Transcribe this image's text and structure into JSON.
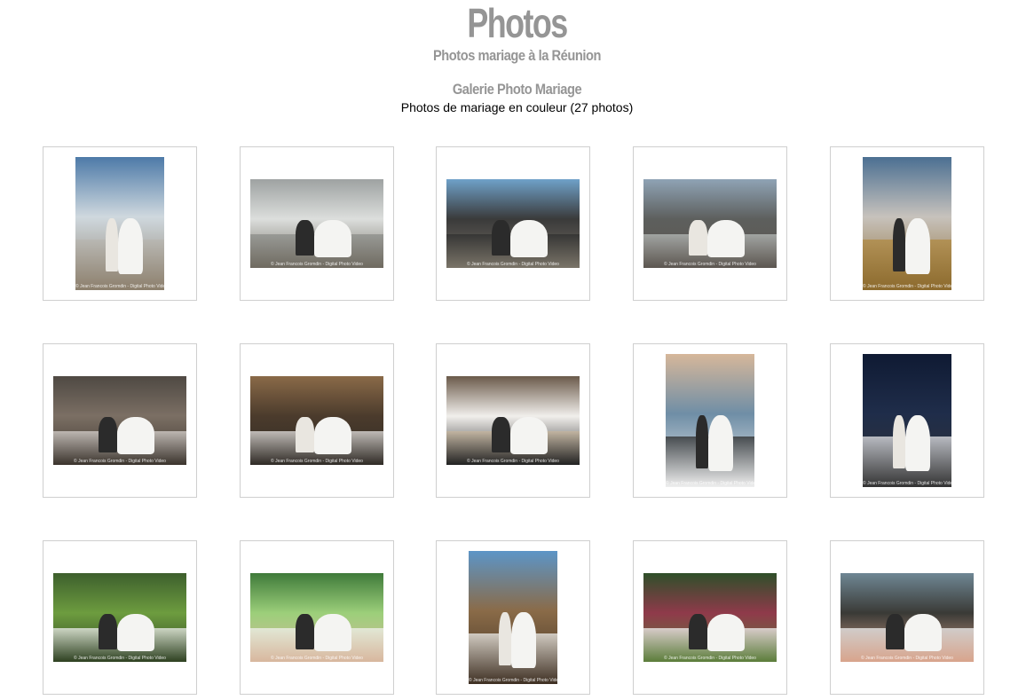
{
  "header": {
    "title": "Photos",
    "subtitle": "Photos mariage à la Réunion"
  },
  "gallery": {
    "title": "Galerie Photo Mariage",
    "description": "Photos de mariage en couleur (27 photos)",
    "watermark": "© Jean Francois Gromdin - Digital Photo Video",
    "thumbnails": [
      {
        "orientation": "portrait",
        "scene": "beach-sky",
        "colors": [
          "#4d7aa8",
          "#cfd8de",
          "#b8b6b0",
          "#8c7f6c"
        ]
      },
      {
        "orientation": "landscape",
        "scene": "wave-splash",
        "colors": [
          "#9ea2a2",
          "#dcdedc",
          "#8d8f8b",
          "#6f6a60"
        ]
      },
      {
        "orientation": "landscape",
        "scene": "rocks-sea",
        "colors": [
          "#6fa1c9",
          "#3a3a3a",
          "#2f2f2f",
          "#7a7468"
        ]
      },
      {
        "orientation": "landscape",
        "scene": "rocks-splash",
        "colors": [
          "#8fa3b5",
          "#5d5f5d",
          "#b8bcba",
          "#5c5650"
        ]
      },
      {
        "orientation": "portrait",
        "scene": "field-couple",
        "colors": [
          "#4b6f92",
          "#c7c2bc",
          "#b08a43",
          "#8c6a2d"
        ]
      },
      {
        "orientation": "landscape",
        "scene": "water-couple",
        "colors": [
          "#4f4943",
          "#7b6f64",
          "#d9d4d0",
          "#3a332c"
        ]
      },
      {
        "orientation": "landscape",
        "scene": "stairs-couple",
        "colors": [
          "#8a6a48",
          "#4b3b2c",
          "#e8e6e4",
          "#2f2a25"
        ]
      },
      {
        "orientation": "landscape",
        "scene": "sand-lying",
        "colors": [
          "#6b5a4a",
          "#f1efec",
          "#c7b69d",
          "#222"
        ]
      },
      {
        "orientation": "portrait",
        "scene": "sunset-sitting",
        "colors": [
          "#d6b79a",
          "#6f8ea6",
          "#2c2c2c",
          "#efefef"
        ]
      },
      {
        "orientation": "portrait",
        "scene": "night-couple",
        "colors": [
          "#0f1a33",
          "#1f2d4a",
          "#e8e8ea",
          "#333"
        ]
      },
      {
        "orientation": "landscape",
        "scene": "garden-couple",
        "colors": [
          "#3d5f2d",
          "#6d9c3f",
          "#f3f3f3",
          "#2d4020"
        ]
      },
      {
        "orientation": "landscape",
        "scene": "tropical-closeup",
        "colors": [
          "#3f7a3a",
          "#9ccf7a",
          "#f2f2ef",
          "#d8b79e"
        ]
      },
      {
        "orientation": "portrait",
        "scene": "palm-barrel",
        "colors": [
          "#5c95c7",
          "#8a6b48",
          "#efefec",
          "#3e2f22"
        ]
      },
      {
        "orientation": "landscape",
        "scene": "flower-garden",
        "colors": [
          "#2f4f2a",
          "#8f3a4a",
          "#f5f5f5",
          "#5b7d3a"
        ]
      },
      {
        "orientation": "landscape",
        "scene": "sea-closeup",
        "colors": [
          "#6f8794",
          "#3a3a36",
          "#f2f2f2",
          "#d8a48c"
        ]
      }
    ]
  }
}
